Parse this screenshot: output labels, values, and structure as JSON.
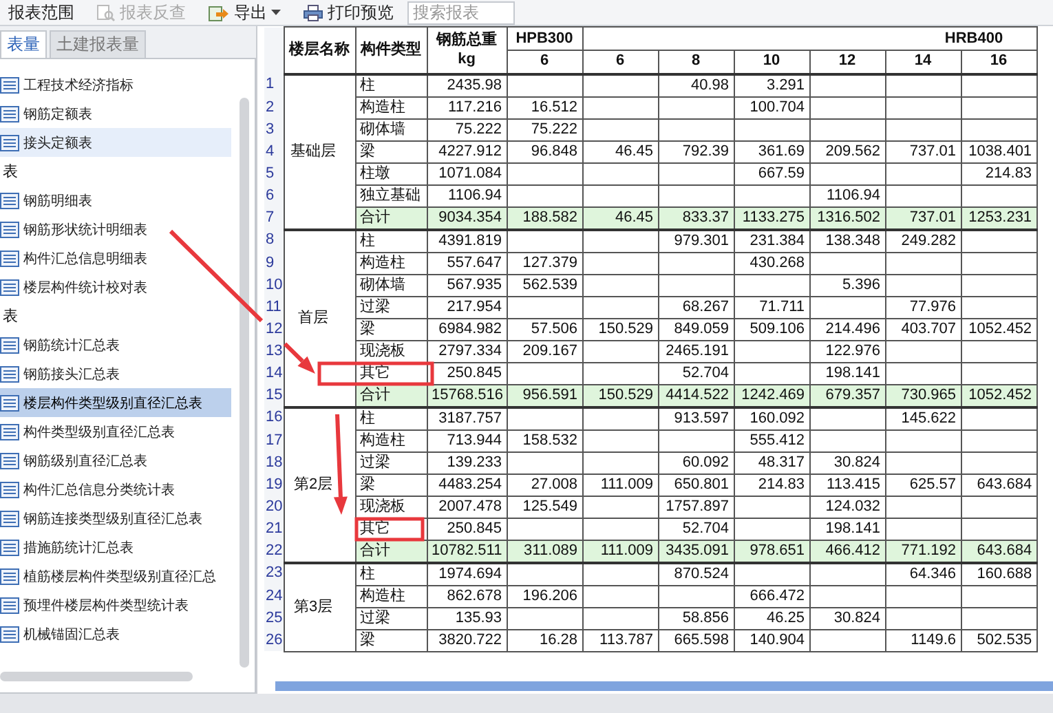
{
  "toolbar": {
    "buttons": [
      {
        "kind": "plain",
        "label": "报表范围",
        "disabled": false,
        "dropdown": false
      },
      {
        "kind": "find",
        "label": "报表反查",
        "disabled": true,
        "dropdown": false
      },
      {
        "kind": "export",
        "label": "导出",
        "disabled": false,
        "dropdown": true
      },
      {
        "kind": "print",
        "label": "打印预览",
        "disabled": false,
        "dropdown": false
      }
    ],
    "search": {
      "placeholder": "搜索报表"
    }
  },
  "tabs": [
    {
      "label": "表量",
      "selected": true
    },
    {
      "label": "土建报表量",
      "selected": false
    }
  ],
  "report_list": [
    {
      "kind": "report",
      "label": "工程技术经济指标",
      "selected": false,
      "highlighted": false
    },
    {
      "kind": "report",
      "label": "钢筋定额表",
      "selected": false,
      "highlighted": false
    },
    {
      "kind": "report",
      "label": "接头定额表",
      "selected": false,
      "highlighted": true
    },
    {
      "kind": "header",
      "label": "表"
    },
    {
      "kind": "report",
      "label": "钢筋明细表",
      "selected": false,
      "highlighted": false
    },
    {
      "kind": "report",
      "label": "钢筋形状统计明细表",
      "selected": false,
      "highlighted": false
    },
    {
      "kind": "report",
      "label": "构件汇总信息明细表",
      "selected": false,
      "highlighted": false
    },
    {
      "kind": "report",
      "label": "楼层构件统计校对表",
      "selected": false,
      "highlighted": false
    },
    {
      "kind": "header",
      "label": "表"
    },
    {
      "kind": "report",
      "label": "钢筋统计汇总表",
      "selected": false,
      "highlighted": false
    },
    {
      "kind": "report",
      "label": "钢筋接头汇总表",
      "selected": false,
      "highlighted": false
    },
    {
      "kind": "report",
      "label": "楼层构件类型级别直径汇总表",
      "selected": true,
      "highlighted": false
    },
    {
      "kind": "report",
      "label": "构件类型级别直径汇总表",
      "selected": false,
      "highlighted": false
    },
    {
      "kind": "report",
      "label": "钢筋级别直径汇总表",
      "selected": false,
      "highlighted": false
    },
    {
      "kind": "report",
      "label": "构件汇总信息分类统计表",
      "selected": false,
      "highlighted": false
    },
    {
      "kind": "report",
      "label": "钢筋连接类型级别直径汇总表",
      "selected": false,
      "highlighted": false
    },
    {
      "kind": "report",
      "label": "措施筋统计汇总表",
      "selected": false,
      "highlighted": false
    },
    {
      "kind": "report",
      "label": "植筋楼层构件类型级别直径汇总",
      "selected": false,
      "highlighted": false
    },
    {
      "kind": "report",
      "label": "预埋件楼层构件类型统计表",
      "selected": false,
      "highlighted": false
    },
    {
      "kind": "report",
      "label": "机械锚固汇总表",
      "selected": false,
      "highlighted": false
    }
  ],
  "table": {
    "columns": {
      "floor": "楼层名称",
      "type": "构件类型",
      "total": "钢筋总重",
      "unit": "kg",
      "grades": [
        {
          "name": "HPB300",
          "diameters": [
            "6"
          ]
        },
        {
          "name": "HRB400",
          "diameters": [
            "6",
            "8",
            "10",
            "12",
            "14",
            "16"
          ]
        }
      ]
    },
    "floors": [
      {
        "name": "基础层",
        "rows": [
          {
            "number": "1",
            "kind": "item",
            "boxed": false,
            "type": "柱",
            "total": "2435.98",
            "values": {
              "hrb400_8": "40.98",
              "hrb400_10": "3.291"
            }
          },
          {
            "number": "2",
            "kind": "item",
            "boxed": false,
            "type": "构造柱",
            "total": "117.216",
            "values": {
              "hpb300_6": "16.512",
              "hrb400_10": "100.704"
            }
          },
          {
            "number": "3",
            "kind": "item",
            "boxed": false,
            "type": "砌体墙",
            "total": "75.222",
            "values": {
              "hpb300_6": "75.222"
            }
          },
          {
            "number": "4",
            "kind": "item",
            "boxed": false,
            "type": "梁",
            "total": "4227.912",
            "values": {
              "hpb300_6": "96.848",
              "hrb400_6": "46.45",
              "hrb400_8": "792.39",
              "hrb400_10": "361.69",
              "hrb400_12": "209.562",
              "hrb400_14": "737.01",
              "hrb400_16": "1038.401"
            }
          },
          {
            "number": "5",
            "kind": "item",
            "boxed": false,
            "type": "柱墩",
            "total": "1071.084",
            "values": {
              "hrb400_10": "667.59",
              "hrb400_16": "214.83"
            }
          },
          {
            "number": "6",
            "kind": "item",
            "boxed": false,
            "type": "独立基础",
            "total": "1106.94",
            "values": {
              "hrb400_12": "1106.94"
            }
          },
          {
            "number": "7",
            "kind": "total",
            "boxed": false,
            "type": "合计",
            "total": "9034.354",
            "values": {
              "hpb300_6": "188.582",
              "hrb400_6": "46.45",
              "hrb400_8": "833.37",
              "hrb400_10": "1133.275",
              "hrb400_12": "1316.502",
              "hrb400_14": "737.01",
              "hrb400_16": "1253.231"
            }
          }
        ]
      },
      {
        "name": "首层",
        "rows": [
          {
            "number": "8",
            "kind": "item",
            "boxed": false,
            "type": "柱",
            "total": "4391.819",
            "values": {
              "hrb400_8": "979.301",
              "hrb400_10": "231.384",
              "hrb400_12": "138.348",
              "hrb400_14": "249.282"
            }
          },
          {
            "number": "9",
            "kind": "item",
            "boxed": false,
            "type": "构造柱",
            "total": "557.647",
            "values": {
              "hpb300_6": "127.379",
              "hrb400_10": "430.268"
            }
          },
          {
            "number": "10",
            "kind": "item",
            "boxed": false,
            "type": "砌体墙",
            "total": "567.935",
            "values": {
              "hpb300_6": "562.539",
              "hrb400_12": "5.396"
            }
          },
          {
            "number": "11",
            "kind": "item",
            "boxed": false,
            "type": "过梁",
            "total": "217.954",
            "values": {
              "hrb400_8": "68.267",
              "hrb400_10": "71.711",
              "hrb400_14": "77.976"
            }
          },
          {
            "number": "12",
            "kind": "item",
            "boxed": false,
            "type": "梁",
            "total": "6984.982",
            "values": {
              "hpb300_6": "57.506",
              "hrb400_6": "150.529",
              "hrb400_8": "849.059",
              "hrb400_10": "509.106",
              "hrb400_12": "214.496",
              "hrb400_14": "403.707",
              "hrb400_16": "1052.452"
            }
          },
          {
            "number": "13",
            "kind": "item",
            "boxed": false,
            "type": "现浇板",
            "total": "2797.334",
            "values": {
              "hpb300_6": "209.167",
              "hrb400_8": "2465.191",
              "hrb400_12": "122.976"
            }
          },
          {
            "number": "14",
            "kind": "item",
            "boxed": true,
            "type": "其它",
            "total": "250.845",
            "values": {
              "hrb400_8": "52.704",
              "hrb400_12": "198.141"
            }
          },
          {
            "number": "15",
            "kind": "total",
            "boxed": false,
            "type": "合计",
            "total": "15768.516",
            "values": {
              "hpb300_6": "956.591",
              "hrb400_6": "150.529",
              "hrb400_8": "4414.522",
              "hrb400_10": "1242.469",
              "hrb400_12": "679.357",
              "hrb400_14": "730.965",
              "hrb400_16": "1052.452"
            }
          }
        ]
      },
      {
        "name": "第2层",
        "rows": [
          {
            "number": "16",
            "kind": "item",
            "boxed": false,
            "type": "柱",
            "total": "3187.757",
            "values": {
              "hrb400_8": "913.597",
              "hrb400_10": "160.092",
              "hrb400_14": "145.622"
            }
          },
          {
            "number": "17",
            "kind": "item",
            "boxed": false,
            "type": "构造柱",
            "total": "713.944",
            "values": {
              "hpb300_6": "158.532",
              "hrb400_10": "555.412"
            }
          },
          {
            "number": "18",
            "kind": "item",
            "boxed": false,
            "type": "过梁",
            "total": "139.233",
            "values": {
              "hrb400_8": "60.092",
              "hrb400_10": "48.317",
              "hrb400_12": "30.824"
            }
          },
          {
            "number": "19",
            "kind": "item",
            "boxed": false,
            "type": "梁",
            "total": "4483.254",
            "values": {
              "hpb300_6": "27.008",
              "hrb400_6": "111.009",
              "hrb400_8": "650.801",
              "hrb400_10": "214.83",
              "hrb400_12": "113.415",
              "hrb400_14": "625.57",
              "hrb400_16": "643.684"
            }
          },
          {
            "number": "20",
            "kind": "item",
            "boxed": false,
            "type": "现浇板",
            "total": "2007.478",
            "values": {
              "hpb300_6": "125.549",
              "hrb400_8": "1757.897",
              "hrb400_12": "124.032"
            }
          },
          {
            "number": "21",
            "kind": "item",
            "boxed": true,
            "type": "其它",
            "total": "250.845",
            "values": {
              "hrb400_8": "52.704",
              "hrb400_12": "198.141"
            }
          },
          {
            "number": "22",
            "kind": "total",
            "boxed": false,
            "type": "合计",
            "total": "10782.511",
            "values": {
              "hpb300_6": "311.089",
              "hrb400_6": "111.009",
              "hrb400_8": "3435.091",
              "hrb400_10": "978.651",
              "hrb400_12": "466.412",
              "hrb400_14": "771.192",
              "hrb400_16": "643.684"
            }
          }
        ]
      },
      {
        "name": "第3层",
        "rows": [
          {
            "number": "23",
            "kind": "item",
            "boxed": false,
            "type": "柱",
            "total": "1974.694",
            "values": {
              "hrb400_8": "870.524",
              "hrb400_14": "64.346",
              "hrb400_16": "160.688"
            }
          },
          {
            "number": "24",
            "kind": "item",
            "boxed": false,
            "type": "构造柱",
            "total": "862.678",
            "values": {
              "hpb300_6": "196.206",
              "hrb400_10": "666.472"
            }
          },
          {
            "number": "25",
            "kind": "item",
            "boxed": false,
            "type": "过梁",
            "total": "135.93",
            "values": {
              "hrb400_8": "58.856",
              "hrb400_10": "46.25",
              "hrb400_12": "30.824"
            }
          },
          {
            "number": "26",
            "kind": "item",
            "boxed": false,
            "type": "梁",
            "total": "3820.722",
            "values": {
              "hpb300_6": "16.28",
              "hrb400_6": "113.787",
              "hrb400_8": "665.598",
              "hrb400_10": "140.904",
              "hrb400_14": "1149.6",
              "hrb400_16": "502.535"
            }
          }
        ]
      }
    ]
  }
}
